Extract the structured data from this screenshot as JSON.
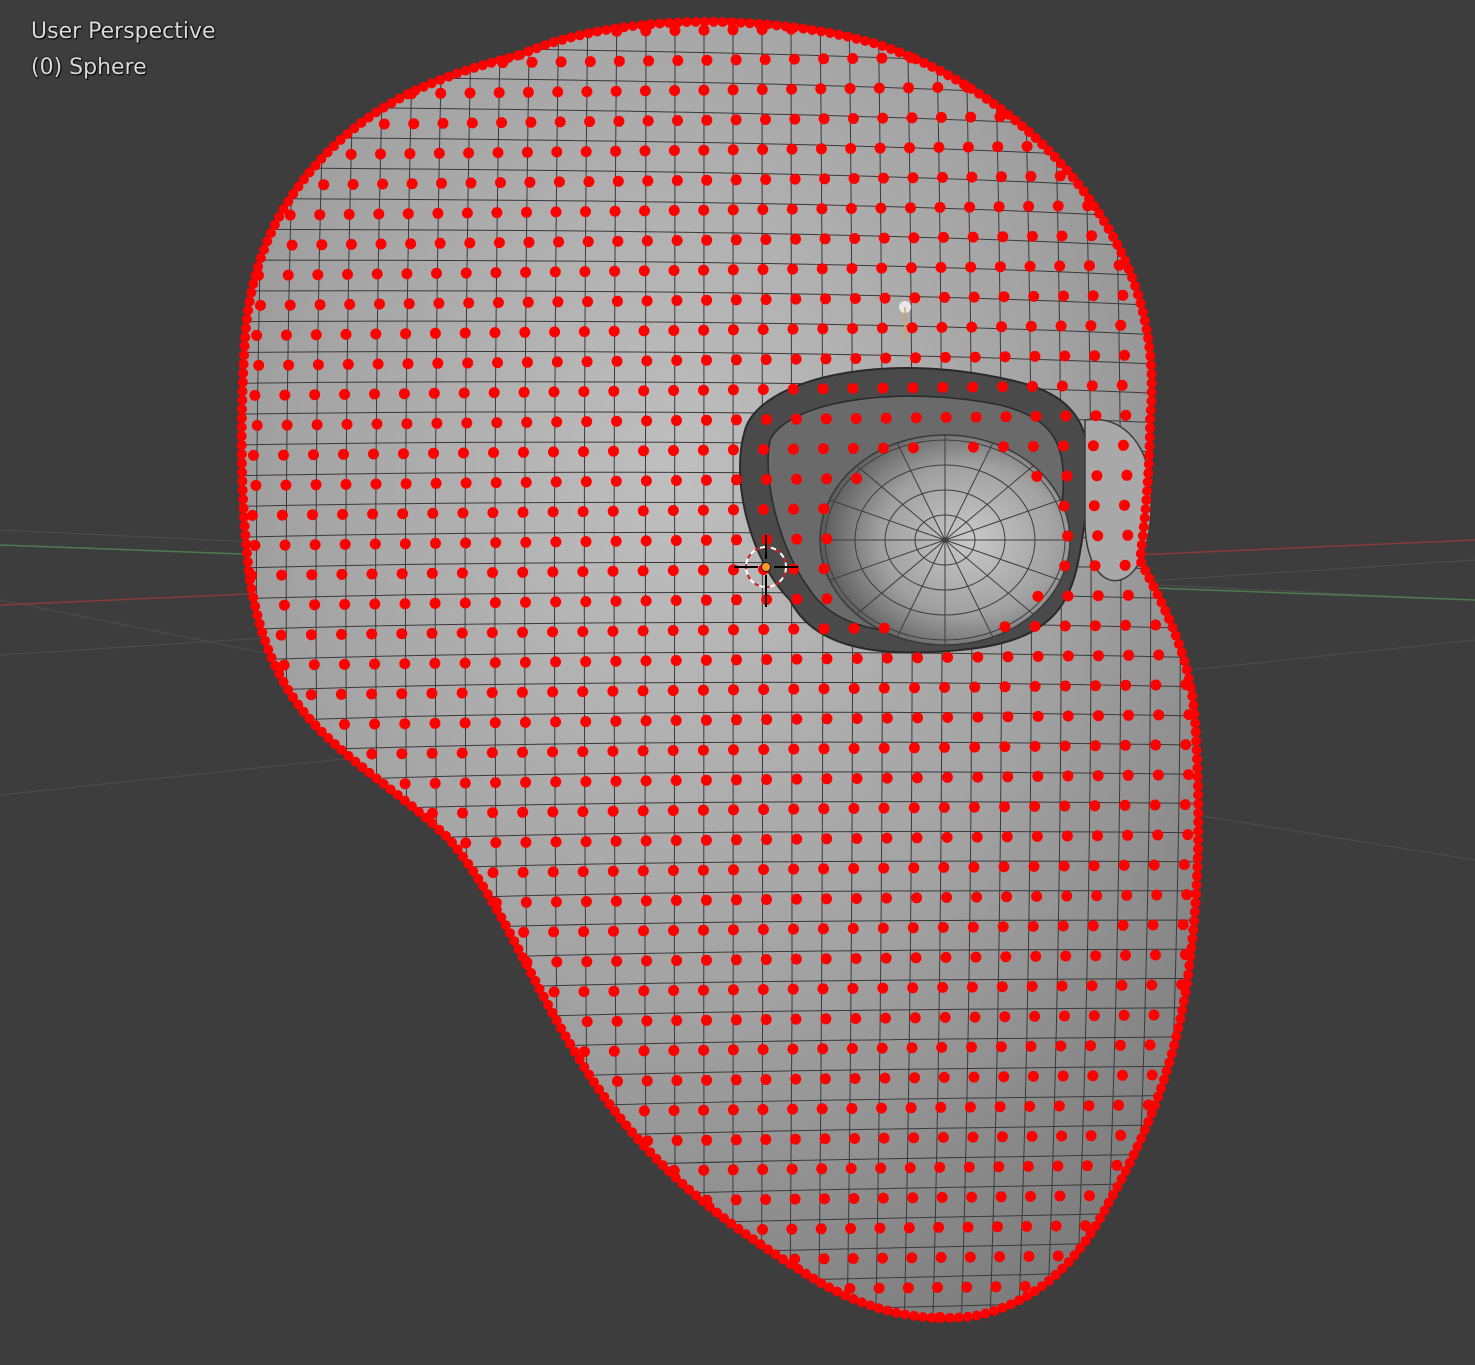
{
  "viewport": {
    "view_label": "User Perspective",
    "object_label": "(0) Sphere"
  },
  "colors": {
    "background": "#3d3d3d",
    "mesh_face": "#9a9a9a",
    "mesh_edge": "#3a3a3a",
    "selected_vertex": "#ff0000",
    "active_vertex": "#e8e8e8",
    "x_axis": "#8a3a3a",
    "y_axis": "#4e7a4e",
    "grid": "#565656",
    "origin": "#ff9a2a"
  },
  "icons": [
    "3d-cursor-icon",
    "object-origin-icon"
  ]
}
